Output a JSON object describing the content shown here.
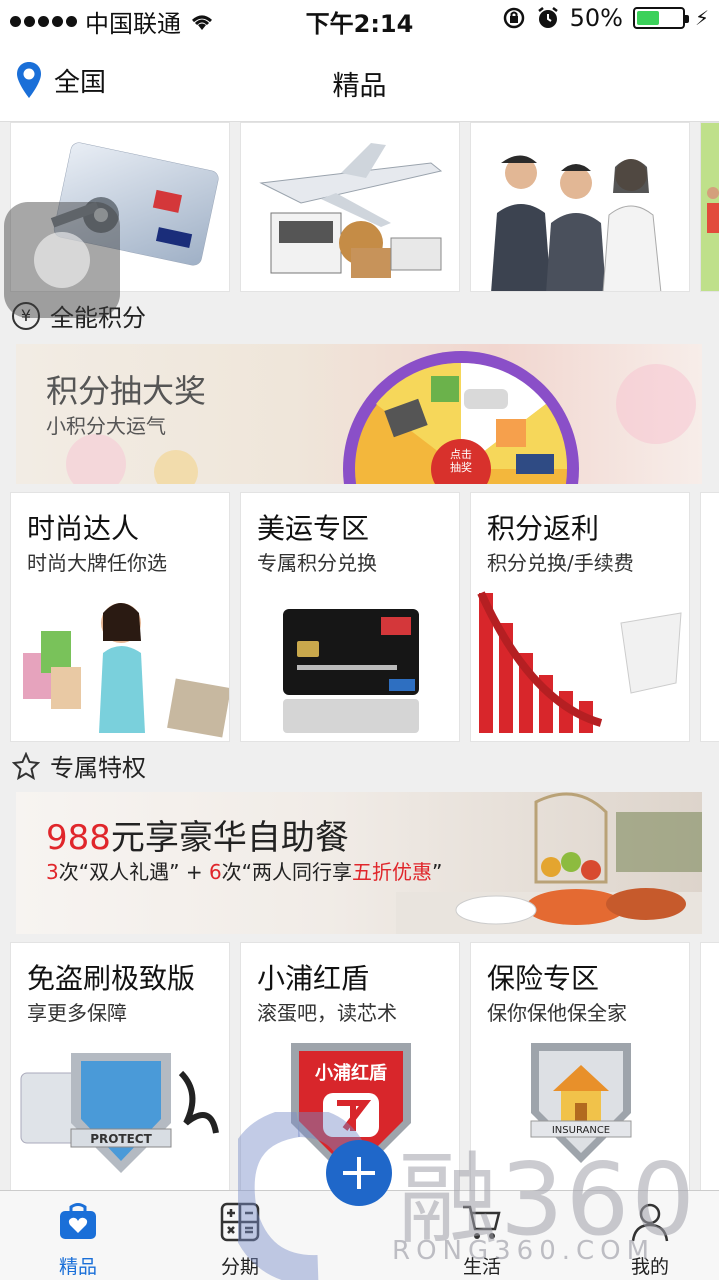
{
  "status_bar": {
    "carrier": "中国联通",
    "time": "下午2:14",
    "battery": "50%",
    "battery_level": 0.5
  },
  "nav": {
    "location": "全国",
    "title": "精品"
  },
  "sections": {
    "points": {
      "title": "全能积分",
      "icon": "yen-circle-icon"
    },
    "privilege": {
      "title": "专属特权",
      "icon": "star-outline-icon"
    }
  },
  "points_banner": {
    "title": "积分抽大奖",
    "subtitle": "小积分大运气",
    "wheel_label_1": "点击",
    "wheel_label_2": "抽奖"
  },
  "points_tiles": [
    {
      "title": "时尚达人",
      "subtitle": "时尚大牌任你选"
    },
    {
      "title": "美运专区",
      "subtitle": "专属积分兑换"
    },
    {
      "title": "积分返利",
      "subtitle": "积分兑换/手续费"
    }
  ],
  "buffet_banner": {
    "price": "988",
    "title_rest": "元享豪华自助餐",
    "line_a_num": "3",
    "line_a_text": "次“双人礼遇”  + ",
    "line_b_num": "6",
    "line_b_text": "次“两人同行享",
    "line_b_highlight": "五折优惠",
    "line_b_end": "”"
  },
  "privilege_tiles": [
    {
      "title": "免盗刷极致版",
      "subtitle": "享更多保障",
      "badge": "PROTECT"
    },
    {
      "title": "小浦红盾",
      "subtitle": "滚蛋吧，读芯术",
      "badge": "小浦红盾"
    },
    {
      "title": "保险专区",
      "subtitle": "保你保他保全家",
      "badge": "INSURANCE"
    }
  ],
  "tabs": [
    {
      "label": "精品",
      "icon": "bag-heart-icon",
      "active": true
    },
    {
      "label": "分期",
      "icon": "calculator-icon",
      "active": false
    },
    {
      "label": "生活",
      "icon": "cart-icon",
      "active": false
    },
    {
      "label": "我的",
      "icon": "person-icon",
      "active": false
    }
  ],
  "watermark": {
    "main": "融360",
    "sub": "RONG360.COM"
  },
  "colors": {
    "accent": "#1a6fd8",
    "highlight_red": "#e0262b",
    "battery_green": "#3bd15a"
  }
}
